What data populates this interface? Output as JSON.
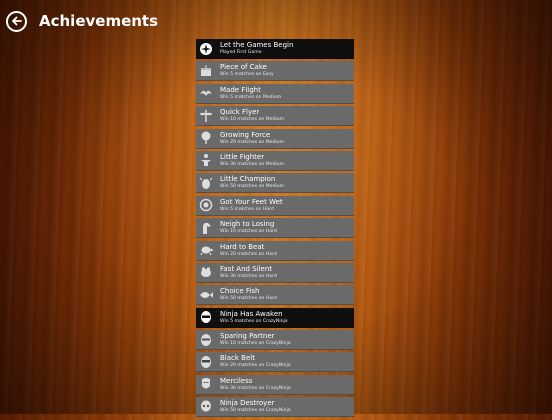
{
  "header": {
    "title": "Achievements"
  },
  "achievements": [
    {
      "title": "Let the Games Begin",
      "desc": "Played First Game",
      "icon": "ninja-star-icon",
      "unlocked": true
    },
    {
      "title": "Piece of Cake",
      "desc": "Win 5 matches on Easy",
      "icon": "cake-icon",
      "unlocked": false
    },
    {
      "title": "Made Flight",
      "desc": "Win 5 matches on Medium",
      "icon": "bird-icon",
      "unlocked": false
    },
    {
      "title": "Quick Flyer",
      "desc": "Win 10 matches on Medium",
      "icon": "dragonfly-icon",
      "unlocked": false
    },
    {
      "title": "Growing Force",
      "desc": "Win 20 matches on Medium",
      "icon": "tree-icon",
      "unlocked": false
    },
    {
      "title": "Little Fighter",
      "desc": "Win 30 matches on Medium",
      "icon": "fighter-icon",
      "unlocked": false
    },
    {
      "title": "Little Champion",
      "desc": "Win 50 matches on Medium",
      "icon": "beetle-icon",
      "unlocked": false
    },
    {
      "title": "Got Your Feet Wet",
      "desc": "Win 5 matches on Hard",
      "icon": "shell-icon",
      "unlocked": false
    },
    {
      "title": "Neigh to Losing",
      "desc": "Win 10 matches on Hard",
      "icon": "horse-icon",
      "unlocked": false
    },
    {
      "title": "Hard to Beat",
      "desc": "Win 20 matches on Hard",
      "icon": "turtle-icon",
      "unlocked": false
    },
    {
      "title": "Fast And Silent",
      "desc": "Win 30 matches on Hard",
      "icon": "frog-icon",
      "unlocked": false
    },
    {
      "title": "Choice Fish",
      "desc": "Win 50 matches on Hard",
      "icon": "fish-icon",
      "unlocked": false
    },
    {
      "title": "Ninja Has Awaken",
      "desc": "Win 5 matches on CrazyNinja",
      "icon": "ninja-face-icon",
      "unlocked": true
    },
    {
      "title": "Sparing Partner",
      "desc": "Win 10 matches on CrazyNinja",
      "icon": "ninja-mask-icon",
      "unlocked": false
    },
    {
      "title": "Black Belt",
      "desc": "Win 20 matches on CrazyNinja",
      "icon": "ninja-head-icon",
      "unlocked": false
    },
    {
      "title": "Merciless",
      "desc": "Win 30 matches on CrazyNinja",
      "icon": "mask-icon",
      "unlocked": false
    },
    {
      "title": "Ninja Destroyer",
      "desc": "Win 50 matches on CrazyNinja",
      "icon": "skull-mask-icon",
      "unlocked": false
    }
  ]
}
